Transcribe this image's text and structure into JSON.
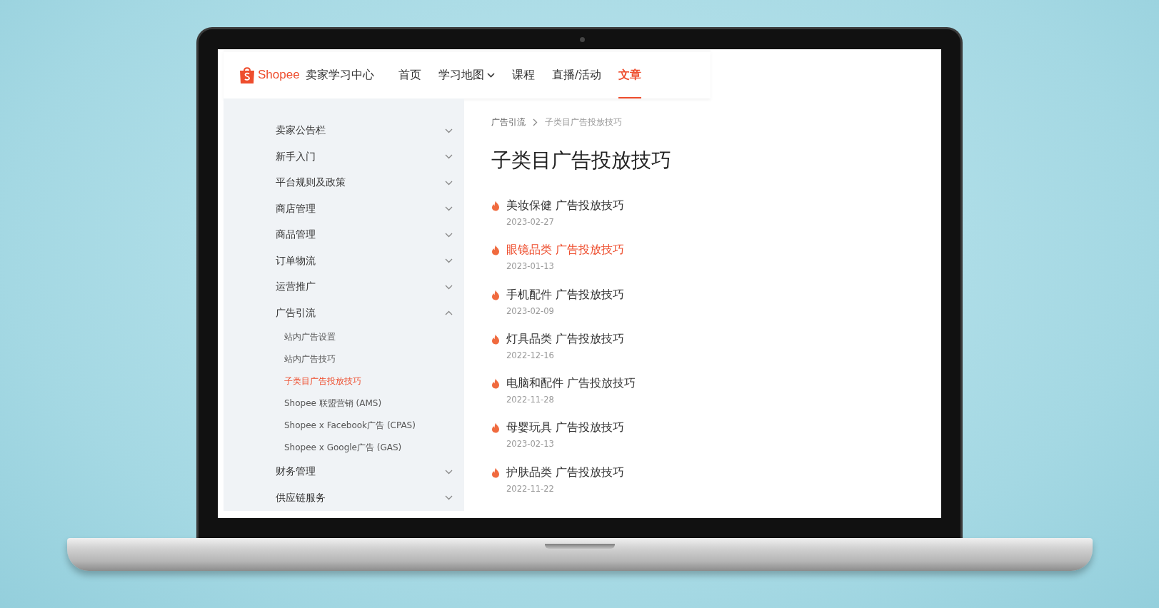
{
  "header": {
    "logo_text": "Shopee",
    "site_name": "卖家学习中心",
    "nav": [
      {
        "label": "首页",
        "selected": false,
        "dropdown": false
      },
      {
        "label": "学习地图",
        "selected": false,
        "dropdown": true
      },
      {
        "label": "课程",
        "selected": false,
        "dropdown": false
      },
      {
        "label": "直播/活动",
        "selected": false,
        "dropdown": false
      },
      {
        "label": "文章",
        "selected": true,
        "dropdown": false
      }
    ]
  },
  "sidebar": {
    "items": [
      {
        "label": "卖家公告栏",
        "expanded": false
      },
      {
        "label": "新手入门",
        "expanded": false
      },
      {
        "label": "平台规则及政策",
        "expanded": false
      },
      {
        "label": "商店管理",
        "expanded": false
      },
      {
        "label": "商品管理",
        "expanded": false
      },
      {
        "label": "订单物流",
        "expanded": false
      },
      {
        "label": "运营推广",
        "expanded": false
      },
      {
        "label": "广告引流",
        "expanded": true,
        "children": [
          {
            "label": "站内广告设置",
            "selected": false
          },
          {
            "label": "站内广告技巧",
            "selected": false
          },
          {
            "label": "子类目广告投放技巧",
            "selected": true
          },
          {
            "label": "Shopee 联盟营销 (AMS)",
            "selected": false
          },
          {
            "label": "Shopee x Facebook广告 (CPAS)",
            "selected": false
          },
          {
            "label": "Shopee x Google广告 (GAS)",
            "selected": false
          }
        ]
      },
      {
        "label": "财务管理",
        "expanded": false
      },
      {
        "label": "供应链服务",
        "expanded": false
      }
    ]
  },
  "breadcrumb": [
    "广告引流",
    "子类目广告投放技巧"
  ],
  "title": "子类目广告投放技巧",
  "articles": [
    {
      "title": "美妆保健 广告投放技巧",
      "date": "2023-02-27",
      "highlighted": false
    },
    {
      "title": "眼镜品类 广告投放技巧",
      "date": "2023-01-13",
      "highlighted": true
    },
    {
      "title": "手机配件 广告投放技巧",
      "date": "2023-02-09",
      "highlighted": false
    },
    {
      "title": "灯具品类 广告投放技巧",
      "date": "2022-12-16",
      "highlighted": false
    },
    {
      "title": "电脑和配件 广告投放技巧",
      "date": "2022-11-28",
      "highlighted": false
    },
    {
      "title": "母婴玩具 广告投放技巧",
      "date": "2023-02-13",
      "highlighted": false
    },
    {
      "title": "护肤品类 广告投放技巧",
      "date": "2022-11-22",
      "highlighted": false
    }
  ]
}
